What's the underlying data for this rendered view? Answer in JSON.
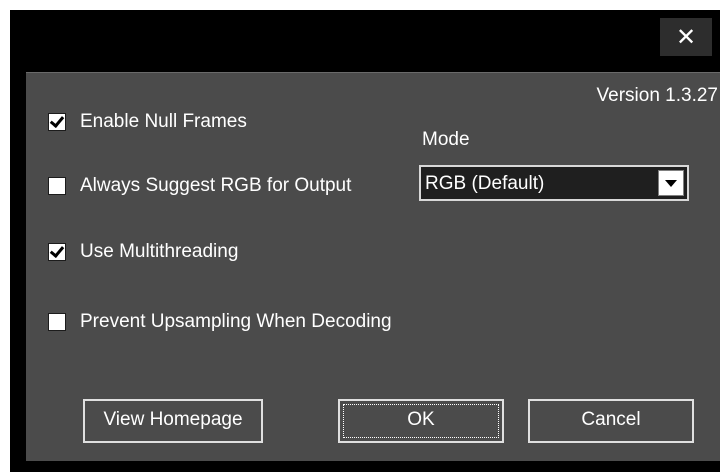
{
  "window": {
    "close_label": "✕",
    "close_icon": "close-icon"
  },
  "panel": {
    "version": "Version 1.3.27",
    "options": [
      {
        "label": "Enable Null Frames",
        "checked": true
      },
      {
        "label": "Always Suggest RGB for Output",
        "checked": false
      },
      {
        "label": "Use Multithreading",
        "checked": true
      },
      {
        "label": "Prevent Upsampling When Decoding",
        "checked": false
      }
    ],
    "mode": {
      "label": "Mode",
      "selected": "RGB (Default)",
      "arrow_icon": "chevron-down-icon"
    }
  },
  "buttons": {
    "homepage": "View Homepage",
    "ok": "OK",
    "cancel": "Cancel"
  },
  "colors": {
    "panel_bg": "#4b4b4b",
    "titlebar_bg": "#000000",
    "text": "#ffffff"
  }
}
